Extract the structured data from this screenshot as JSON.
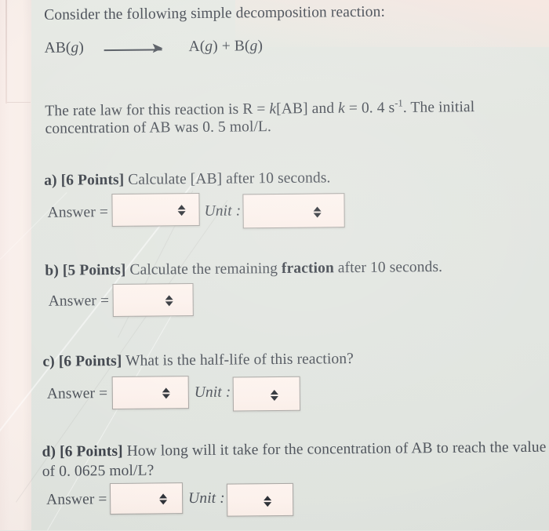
{
  "document": {
    "intro_line1": "Consider the following simple decomposition reaction:",
    "reaction": {
      "reactant": "AB(",
      "reactant_state": "g",
      "reactant_close": ")",
      "arrow_icon": "long-right-arrow",
      "product_a": "A(",
      "product_a_state": "g",
      "product_a_close": ") ",
      "plus": "+",
      "product_b": " B(",
      "product_b_state": "g",
      "product_b_close": ")"
    },
    "rate_law": {
      "text_1": "The rate law for this reaction is R = ",
      "k_italic_1": "k",
      "text_2": "[AB] and ",
      "k_italic_2": "k",
      "text_3": " = 0. 4 s",
      "superscript": "-1",
      "text_4": ". The initial",
      "line2": "concentration of AB was 0. 5 mol/L."
    },
    "questions": [
      {
        "label": "a)",
        "points": "[6 Points]",
        "prompt": " Calculate [AB] after 10 seconds.",
        "answer_label": "Answer =",
        "answer_value": "",
        "unit_label": "Unit :",
        "unit_value": "",
        "has_unit": true
      },
      {
        "label": "b)",
        "points": "[5 Points]",
        "prompt_pre": " Calculate the remaining ",
        "prompt_bold": "fraction",
        "prompt_post": " after 10 seconds.",
        "answer_label": "Answer =",
        "answer_value": "",
        "has_unit": false
      },
      {
        "label": "c)",
        "points": "[6 Points]",
        "prompt": " What is the half-life of this reaction?",
        "answer_label": "Answer =",
        "answer_value": "",
        "unit_label": "Unit :",
        "unit_value": "",
        "has_unit": true
      },
      {
        "label": "d)",
        "points": "[6 Points]",
        "prompt": " How long will it take for the concentration of AB to reach the value",
        "prompt_line2": "of 0. 0625 mol/L?",
        "answer_label": "Answer =",
        "answer_value": "",
        "unit_label": "Unit :",
        "unit_value": "",
        "has_unit": true
      }
    ]
  },
  "colors": {
    "page_background": "#e2e5e0",
    "margin_strip": "#f8eee9",
    "text": "#4d525a",
    "field_fill": "#fcf2ec",
    "field_border": "#a9a6a3",
    "spinner": "#2e3238"
  }
}
